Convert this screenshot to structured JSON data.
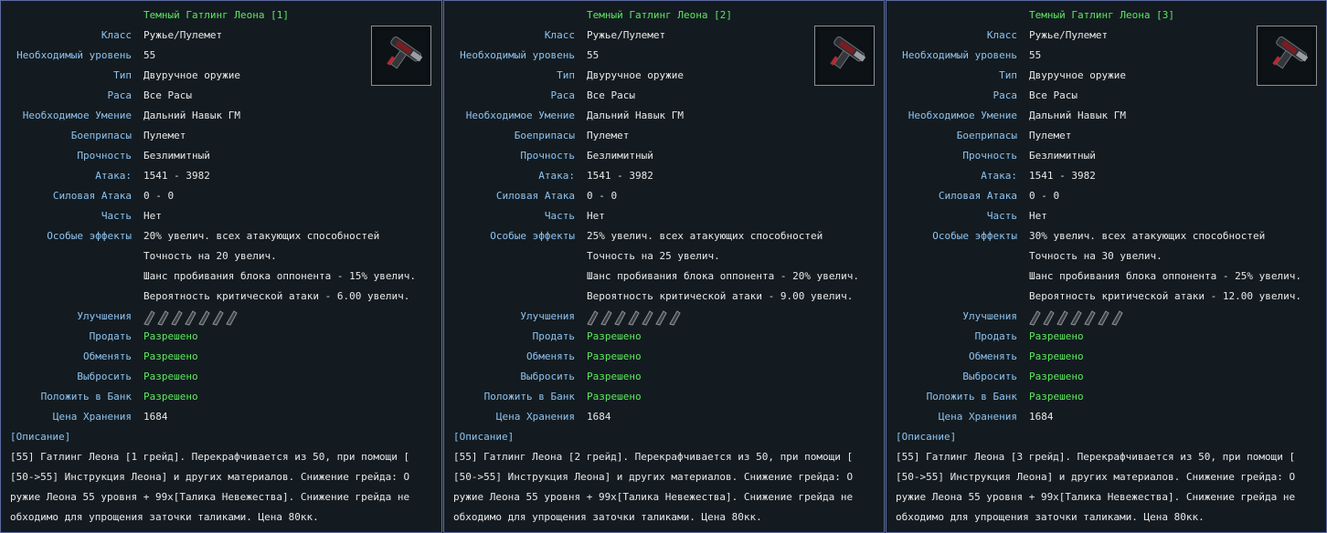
{
  "labels": {
    "class": "Класс",
    "level": "Необходимый уровень",
    "type": "Тип",
    "race": "Раса",
    "skill": "Необходимое Умение",
    "ammo": "Боеприпасы",
    "durability": "Прочность",
    "attack": "Атака:",
    "power_attack": "Силовая Атака",
    "part": "Часть",
    "special": "Особые эффекты",
    "upgrades": "Улучшения",
    "sell": "Продать",
    "trade": "Обменять",
    "drop": "Выбросить",
    "bank": "Положить в Банк",
    "storage_price": "Цена Хранения",
    "description_header": "[Описание]"
  },
  "icons": {
    "weapon": "gatling-gun-icon",
    "upgrade_slot": "upgrade-slot-icon"
  },
  "colors": {
    "accent_green": "#5ee85e",
    "label_blue": "#8ec3f0",
    "text": "#e8e8e8",
    "panel_border": "#5d6ba0"
  },
  "panels": [
    {
      "title": "Темный Гатлинг Леона [1]",
      "class": "Ружье/Пулемет",
      "level": "55",
      "type": "Двуручное оружие",
      "race": "Все Расы",
      "skill": "Дальний Навык ГМ",
      "ammo": "Пулемет",
      "durability": "Безлимитный",
      "attack": "1541 - 3982",
      "power_attack": "0 - 0",
      "part": "Нет",
      "effect1": "20% увелич. всех атакующих способностей",
      "effect2": "Точность на 20 увелич.",
      "effect3": "Шанс пробивания блока оппонента - 15% увелич.",
      "effect4": "Вероятность критической атаки - 6.00 увелич.",
      "sell": "Разрешено",
      "trade": "Разрешено",
      "drop": "Разрешено",
      "bank": "Разрешено",
      "storage_price": "1684",
      "description": "[55] Гатлинг Леона [1 грейд]. Перекрафчивается из 50, при помощи [ [50->55] Инструкция Леона] и других материалов. Снижение грейда: О ружие Леона 55 уровня + 99х[Талика Невежества]. Снижение грейда не обходимо для упрощения заточки таликами. Цена 80кк."
    },
    {
      "title": "Темный Гатлинг Леона [2]",
      "class": "Ружье/Пулемет",
      "level": "55",
      "type": "Двуручное оружие",
      "race": "Все Расы",
      "skill": "Дальний Навык ГМ",
      "ammo": "Пулемет",
      "durability": "Безлимитный",
      "attack": "1541 - 3982",
      "power_attack": "0 - 0",
      "part": "Нет",
      "effect1": "25% увелич. всех атакующих способностей",
      "effect2": "Точность на 25 увелич.",
      "effect3": "Шанс пробивания блока оппонента - 20% увелич.",
      "effect4": "Вероятность критической атаки - 9.00 увелич.",
      "sell": "Разрешено",
      "trade": "Разрешено",
      "drop": "Разрешено",
      "bank": "Разрешено",
      "storage_price": "1684",
      "description": "[55] Гатлинг Леона [2 грейд]. Перекрафчивается из 50, при помощи [ [50->55] Инструкция Леона] и других материалов. Снижение грейда: О ружие Леона 55 уровня + 99х[Талика Невежества]. Снижение грейда не обходимо для упрощения заточки таликами. Цена 80кк."
    },
    {
      "title": "Темный Гатлинг Леона [3]",
      "class": "Ружье/Пулемет",
      "level": "55",
      "type": "Двуручное оружие",
      "race": "Все Расы",
      "skill": "Дальний Навык ГМ",
      "ammo": "Пулемет",
      "durability": "Безлимитный",
      "attack": "1541 - 3982",
      "power_attack": "0 - 0",
      "part": "Нет",
      "effect1": "30% увелич. всех атакующих способностей",
      "effect2": "Точность на 30 увелич.",
      "effect3": "Шанс пробивания блока оппонента - 25% увелич.",
      "effect4": "Вероятность критической атаки - 12.00 увелич.",
      "sell": "Разрешено",
      "trade": "Разрешено",
      "drop": "Разрешено",
      "bank": "Разрешено",
      "storage_price": "1684",
      "description": "[55] Гатлинг Леона [3 грейд]. Перекрафчивается из 50, при помощи [ [50->55] Инструкция Леона] и других материалов. Снижение грейда: О ружие Леона 55 уровня + 99х[Талика Невежества]. Снижение грейда не обходимо для упрощения заточки таликами. Цена 80кк."
    }
  ]
}
